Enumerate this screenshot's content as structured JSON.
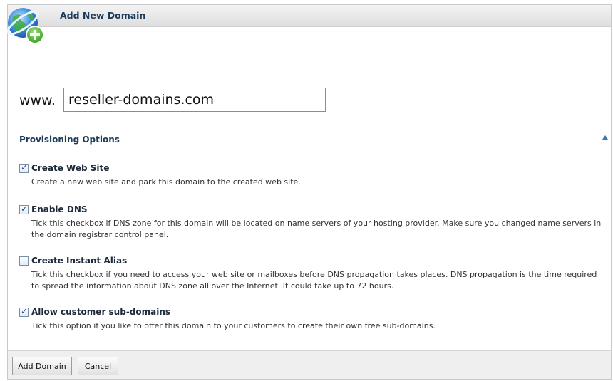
{
  "dialog": {
    "title": "Add New Domain"
  },
  "domain": {
    "prefix": "www.",
    "value": "reseller-domains.com"
  },
  "provisioning": {
    "title": "Provisioning Options",
    "options": [
      {
        "label": "Create Web Site",
        "checked": true,
        "description": "Create a new web site and park this domain to the created web site."
      },
      {
        "label": "Enable DNS",
        "checked": true,
        "description": "Tick this checkbox if DNS zone for this domain will be located on name servers of your hosting provider. Make sure you changed name servers in the domain registrar control panel."
      },
      {
        "label": "Create Instant Alias",
        "checked": false,
        "description": "Tick this checkbox if you need to access your web site or mailboxes before DNS propagation takes places. DNS propagation is the time required to spread the information about DNS zone all over the Internet. It could take up to 72 hours."
      },
      {
        "label": "Allow customer sub-domains",
        "checked": true,
        "description": "Tick this option if you like to offer this domain to your customers to create their own free sub-domains."
      }
    ]
  },
  "buttons": {
    "add_label": "Add Domain",
    "cancel_label": "Cancel"
  }
}
